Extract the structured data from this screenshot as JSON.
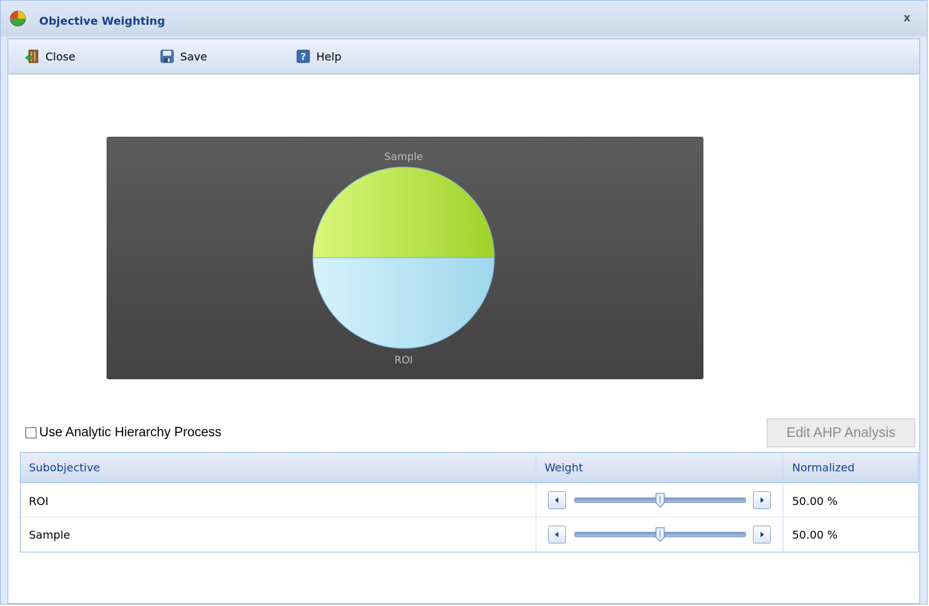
{
  "window": {
    "title": "Objective Weighting",
    "close_glyph": "x"
  },
  "toolbar": {
    "close_label": "Close",
    "save_label": "Save",
    "help_label": "Help"
  },
  "chart_data": {
    "type": "pie",
    "categories": [
      "Sample",
      "ROI"
    ],
    "values": [
      50,
      50
    ],
    "colors": [
      "#b7e34a",
      "#b7e4f2"
    ],
    "title": "",
    "xlabel": "",
    "ylabel": ""
  },
  "ahp": {
    "checkbox_label": "Use Analytic Hierarchy Process",
    "checked": false,
    "edit_button_label": "Edit AHP Analysis"
  },
  "grid": {
    "columns": [
      "Subobjective",
      "Weight",
      "Normalized"
    ],
    "rows": [
      {
        "subobjective": "ROI",
        "weight_fraction": 0.5,
        "normalized": "50.00 %"
      },
      {
        "subobjective": "Sample",
        "weight_fraction": 0.5,
        "normalized": "50.00 %"
      }
    ]
  },
  "colors": {
    "accent": "#15428b",
    "border": "#99bbe8",
    "panel_bg": "#dfe8f6"
  }
}
